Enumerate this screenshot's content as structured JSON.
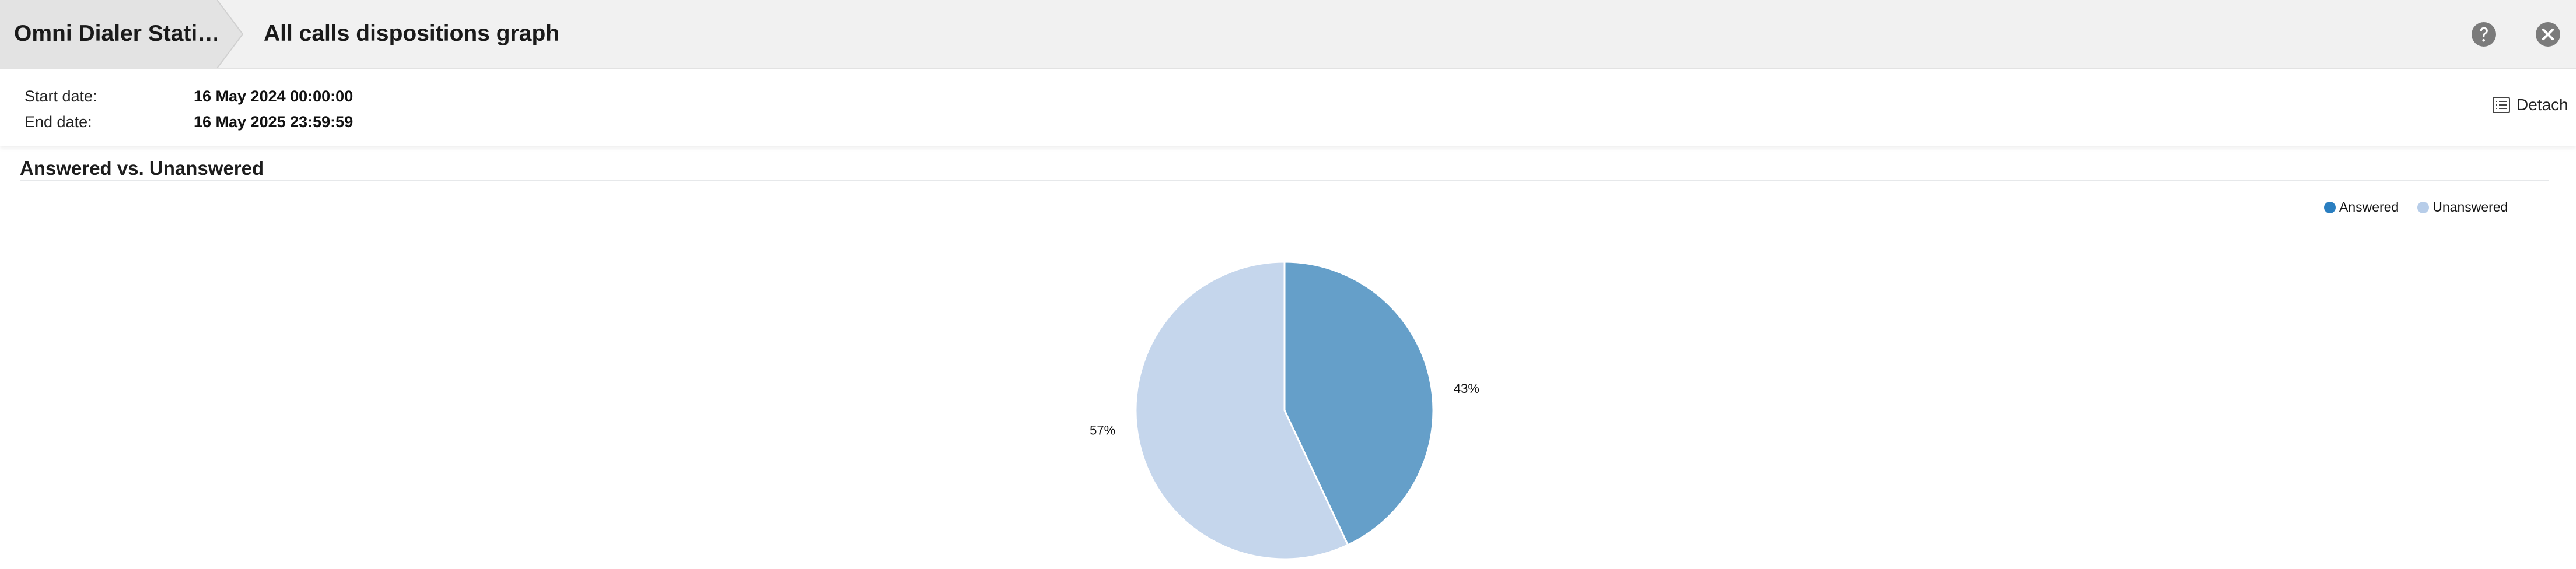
{
  "header": {
    "breadcrumb_root": "Omni Dialer Stati…",
    "title": "All calls dispositions graph",
    "help_icon": "help-circle-icon",
    "close_icon": "close-circle-icon"
  },
  "dates": {
    "start_label": "Start date:",
    "start_value": "16 May 2024 00:00:00",
    "end_label": "End date:",
    "end_value": "16 May 2025 23:59:59"
  },
  "toolbar": {
    "detach_label": "Detach",
    "detach_icon": "list-icon"
  },
  "colors": {
    "answered": "#659fc9",
    "unanswered": "#c5d6ec",
    "legend_answered": "#2a7ec0",
    "legend_unanswered": "#b7cde9"
  },
  "chart_data": {
    "type": "pie",
    "title": "Answered vs. Unanswered",
    "legend_position": "top-right",
    "series": [
      {
        "name": "Answered",
        "value": 43,
        "label": "43%"
      },
      {
        "name": "Unanswered",
        "value": 57,
        "label": "57%"
      }
    ]
  }
}
